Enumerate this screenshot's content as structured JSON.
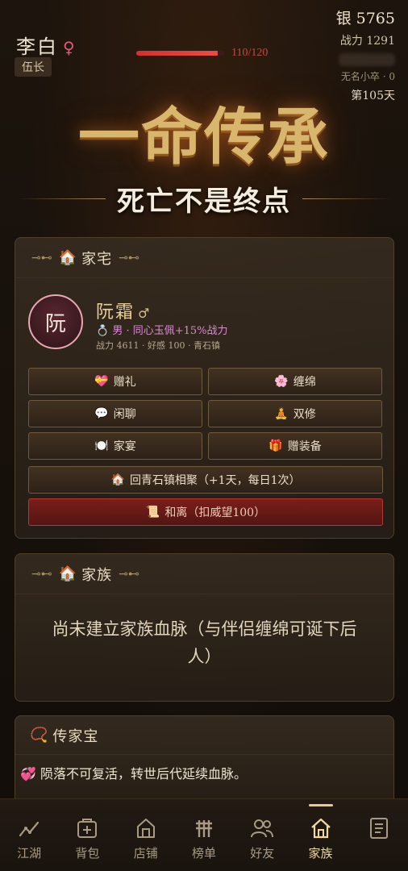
{
  "header": {
    "name": "李白",
    "gender": "♀",
    "rank": "伍长",
    "hp_text": "110/120",
    "hp_fraction": 0.9167,
    "silver": "银 5765",
    "power": "战力 1291",
    "soldier": "无名小卒 · 0",
    "day": "第105天"
  },
  "banner": {
    "title": "一命传承",
    "subtitle": "死亡不是终点"
  },
  "home": {
    "title": "家宅",
    "knot": "⊸⊷",
    "spouse": {
      "avatar_char": "阮",
      "name": "阮霜",
      "gender": "♂",
      "info": "💍 男 · 同心玉佩+15%战力",
      "stats": "战力 4611 · 好感 100 · 青石镇"
    },
    "buttons": [
      {
        "icon": "💝",
        "label": "赠礼"
      },
      {
        "icon": "🌸",
        "label": "缠绵"
      },
      {
        "icon": "💬",
        "label": "闲聊"
      },
      {
        "icon": "🧘",
        "label": "双修"
      },
      {
        "icon": "🍽️",
        "label": "家宴"
      },
      {
        "icon": "🎁",
        "label": "赠装备"
      }
    ],
    "reunite": {
      "icon": "🏠",
      "label": "回青石镇相聚（+1天，每日1次）"
    },
    "divorce": {
      "icon": "📜",
      "label": "和离（扣威望100）"
    }
  },
  "clan": {
    "title": "家族",
    "message": "尚未建立家族血脉（与伴侣缠绵可诞下后人）"
  },
  "heirloom": {
    "title": "传家宝",
    "icon": "📿",
    "text": "💞 陨落不可复活，转世后代延续血脉。"
  },
  "nav": {
    "items": [
      {
        "label": "江湖",
        "icon": "trend-icon"
      },
      {
        "label": "背包",
        "icon": "bag-icon"
      },
      {
        "label": "店铺",
        "icon": "shop-icon"
      },
      {
        "label": "榜单",
        "icon": "ranking-icon"
      },
      {
        "label": "好友",
        "icon": "friends-icon"
      },
      {
        "label": "家族",
        "icon": "home-icon"
      },
      {
        "label": "",
        "icon": "log-icon"
      }
    ],
    "active_index": 5
  }
}
